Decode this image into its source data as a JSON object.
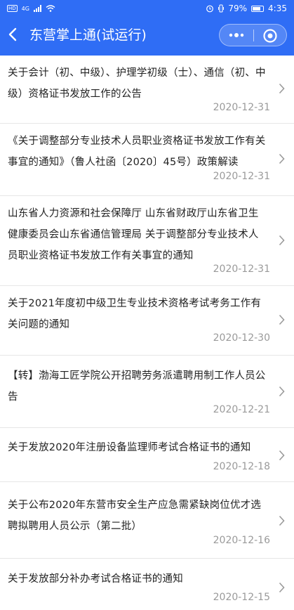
{
  "status_bar": {
    "hd_label": "HD",
    "network_label": "4G",
    "battery_text": "79%",
    "battery_level": 0.79,
    "time": "4:35"
  },
  "nav": {
    "title": "东营掌上通(试运行)",
    "back_icon": "chevron-left-icon",
    "more_icon": "more-dots-icon",
    "close_icon": "target-circle-icon"
  },
  "colors": {
    "header_bg": "#2f6df5",
    "title_text": "#222222",
    "date_text": "#9a9a9a",
    "divider": "#e6e6e6"
  },
  "articles": [
    {
      "title": "关于会计（初、中级）、护理学初级（士）、通信（初、中级）资格证书发放工作的公告",
      "date": "2020-12-31"
    },
    {
      "title": "《关于调整部分专业技术人员职业资格证书发放工作有关事宜的通知》（鲁人社函〔2020〕45号）政策解读",
      "date": "2020-12-31"
    },
    {
      "title": "山东省人力资源和社会保障厅 山东省财政厅山东省卫生健康委员会山东省通信管理局 关于调整部分专业技术人员职业资格证书发放工作有关事宜的通知",
      "date": "2020-12-31"
    },
    {
      "title": "关于2021年度初中级卫生专业技术资格考试考务工作有关问题的通知",
      "date": "2020-12-30"
    },
    {
      "title": "【转】渤海工匠学院公开招聘劳务派遣聘用制工作人员公告",
      "date": "2020-12-21"
    },
    {
      "title": "关于发放2020年注册设备监理师考试合格证书的通知",
      "date": "2020-12-18"
    },
    {
      "title": "关于公布2020年东营市安全生产应急需紧缺岗位优才选聘拟聘用人员公示（第二批）",
      "date": "2020-12-16"
    },
    {
      "title": "关于发放部分补办考试合格证书的通知",
      "date": "2020-12-15"
    }
  ]
}
